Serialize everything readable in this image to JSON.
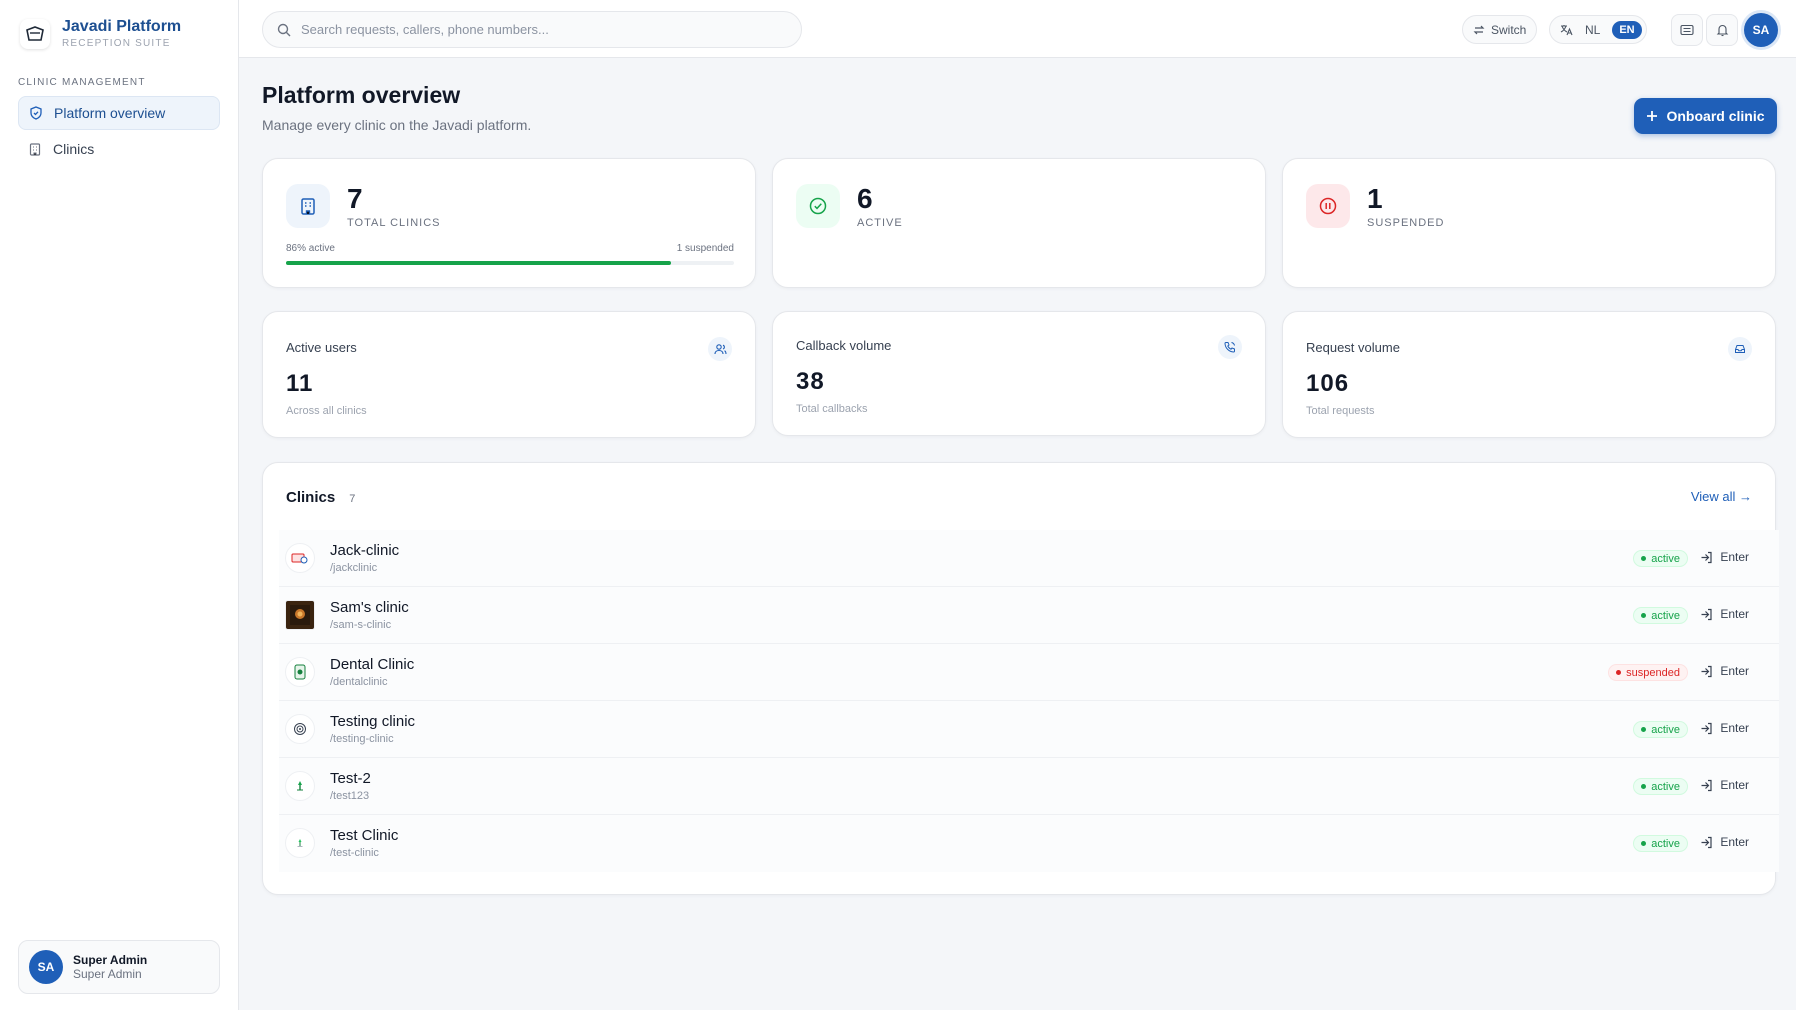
{
  "brand": {
    "name": "Javadi Platform",
    "subtitle": "RECEPTION SUITE"
  },
  "sidebar": {
    "section": "CLINIC MANAGEMENT",
    "items": [
      {
        "label": "Platform overview",
        "icon": "shield-icon",
        "active": true
      },
      {
        "label": "Clinics",
        "icon": "building-icon",
        "active": false
      }
    ],
    "user": {
      "initials": "SA",
      "name": "Super Admin",
      "role": "Super Admin"
    }
  },
  "topbar": {
    "search_placeholder": "Search requests, callers, phone numbers...",
    "switch_label": "Switch",
    "lang_nl": "NL",
    "lang_en": "EN",
    "avatar_initials": "SA"
  },
  "page": {
    "title": "Platform overview",
    "subtitle": "Manage every clinic on the Javadi platform.",
    "onboard_label": "Onboard clinic"
  },
  "stats": [
    {
      "value": "7",
      "label": "TOTAL CLINICS",
      "icon": "building-icon",
      "color": "#1f5fb8"
    },
    {
      "value": "6",
      "label": "ACTIVE",
      "icon": "check-circle-icon",
      "color": "#16a34a"
    },
    {
      "value": "1",
      "label": "SUSPENDED",
      "icon": "pause-circle-icon",
      "color": "#dc2626"
    }
  ],
  "progress": {
    "left_label": "86% active",
    "right_label": "1 suspended",
    "fraction": 0.86
  },
  "metrics": [
    {
      "title": "Active users",
      "value": "11",
      "sub": "Across all clinics",
      "icon": "users-icon"
    },
    {
      "title": "Callback volume",
      "value": "38",
      "sub": "Total callbacks",
      "icon": "phone-icon"
    },
    {
      "title": "Request volume",
      "value": "106",
      "sub": "Total requests",
      "icon": "inbox-icon"
    }
  ],
  "clinics_list": {
    "title": "Clinics",
    "count": "7",
    "view_all": "View all →",
    "enter_label": "Enter",
    "rows": [
      {
        "name": "Jack-clinic",
        "slug": "/jackclinic",
        "status": "active"
      },
      {
        "name": "Sam's clinic",
        "slug": "/sam-s-clinic",
        "status": "active"
      },
      {
        "name": "Dental Clinic",
        "slug": "/dentalclinic",
        "status": "suspended"
      },
      {
        "name": "Testing clinic",
        "slug": "/testing-clinic",
        "status": "active"
      },
      {
        "name": "Test-2",
        "slug": "/test123",
        "status": "active"
      },
      {
        "name": "Test Clinic",
        "slug": "/test-clinic",
        "status": "active"
      }
    ]
  }
}
